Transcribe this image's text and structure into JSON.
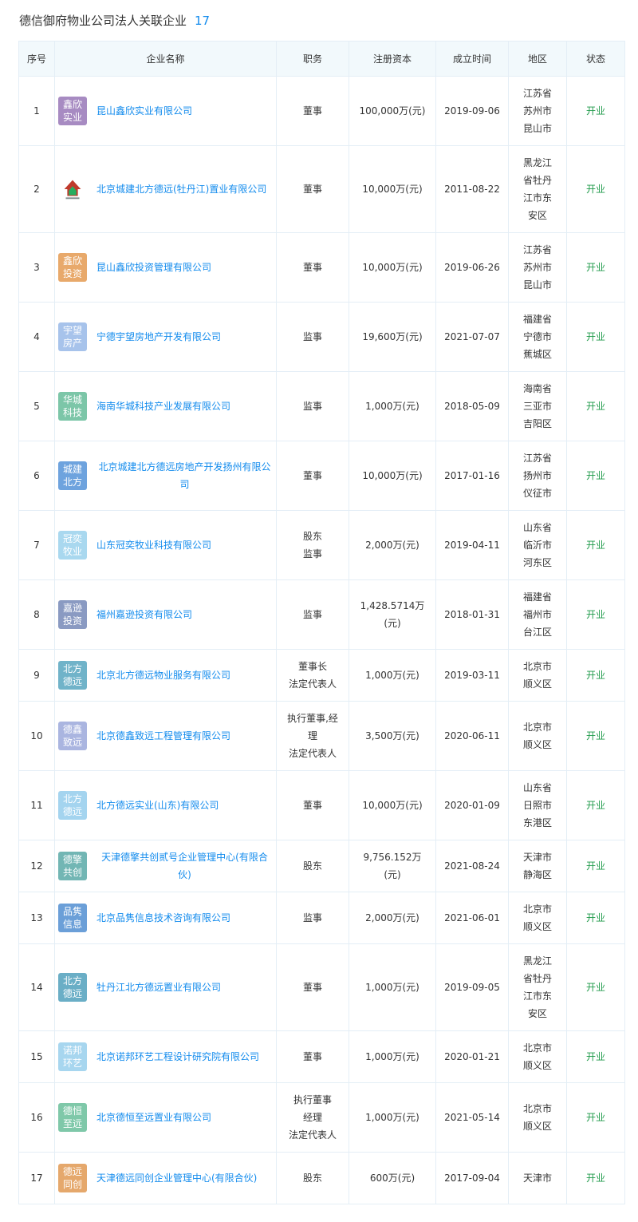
{
  "header": {
    "title": "德信御府物业公司法人关联企业",
    "count": "17"
  },
  "columns": [
    "序号",
    "企业名称",
    "职务",
    "注册资本",
    "成立时间",
    "地区",
    "状态"
  ],
  "rows": [
    {
      "no": "1",
      "logo_text": "鑫欣实业",
      "logo_color": "#a78bc2",
      "name": "昆山鑫欣实业有限公司",
      "role": "董事",
      "capital": "100,000万(元)",
      "date": "2019-09-06",
      "region": "江苏省\n苏州市\n昆山市",
      "status": "开业"
    },
    {
      "no": "2",
      "logo_text": "",
      "logo_color": "#ffffff",
      "logo_icon": "company-logo-image-icon",
      "name": "北京城建北方德远(牡丹江)置业有限公司",
      "role": "董事",
      "capital": "10,000万(元)",
      "date": "2011-08-22",
      "region": "黑龙江\n省牡丹\n江市东\n安区",
      "status": "开业"
    },
    {
      "no": "3",
      "logo_text": "鑫欣投资",
      "logo_color": "#e8a96b",
      "name": "昆山鑫欣投资管理有限公司",
      "role": "董事",
      "capital": "10,000万(元)",
      "date": "2019-06-26",
      "region": "江苏省\n苏州市\n昆山市",
      "status": "开业"
    },
    {
      "no": "4",
      "logo_text": "宇望房产",
      "logo_color": "#a7c3eb",
      "name": "宁德宇望房地产开发有限公司",
      "role": "监事",
      "capital": "19,600万(元)",
      "date": "2021-07-07",
      "region": "福建省\n宁德市\n蕉城区",
      "status": "开业"
    },
    {
      "no": "5",
      "logo_text": "华城科技",
      "logo_color": "#7cc6a8",
      "name": "海南华城科技产业发展有限公司",
      "role": "监事",
      "capital": "1,000万(元)",
      "date": "2018-05-09",
      "region": "海南省\n三亚市\n吉阳区",
      "status": "开业"
    },
    {
      "no": "6",
      "logo_text": "城建北方",
      "logo_color": "#6ea3de",
      "name": "北京城建北方德远房地产开发扬州有限公司",
      "role": "董事",
      "capital": "10,000万(元)",
      "date": "2017-01-16",
      "region": "江苏省\n扬州市\n仪征市",
      "status": "开业"
    },
    {
      "no": "7",
      "logo_text": "冠奕牧业",
      "logo_color": "#a9d8ef",
      "name": "山东冠奕牧业科技有限公司",
      "role": "股东\n监事",
      "capital": "2,000万(元)",
      "date": "2019-04-11",
      "region": "山东省\n临沂市\n河东区",
      "status": "开业"
    },
    {
      "no": "8",
      "logo_text": "嘉逊投资",
      "logo_color": "#8a9ac2",
      "name": "福州嘉逊投资有限公司",
      "role": "监事",
      "capital": "1,428.5714万\n(元)",
      "date": "2018-01-31",
      "region": "福建省\n福州市\n台江区",
      "status": "开业"
    },
    {
      "no": "9",
      "logo_text": "北方德远",
      "logo_color": "#70b3c9",
      "name": "北京北方德远物业服务有限公司",
      "role": "董事长\n法定代表人",
      "capital": "1,000万(元)",
      "date": "2019-03-11",
      "region": "北京市\n顺义区",
      "status": "开业"
    },
    {
      "no": "10",
      "logo_text": "德鑫致远",
      "logo_color": "#aab5e0",
      "name": "北京德鑫致远工程管理有限公司",
      "role": "执行董事,经\n理\n法定代表人",
      "capital": "3,500万(元)",
      "date": "2020-06-11",
      "region": "北京市\n顺义区",
      "status": "开业"
    },
    {
      "no": "11",
      "logo_text": "北方德远",
      "logo_color": "#a4d4ef",
      "name": "北方德远实业(山东)有限公司",
      "role": "董事",
      "capital": "10,000万(元)",
      "date": "2020-01-09",
      "region": "山东省\n日照市\n东港区",
      "status": "开业"
    },
    {
      "no": "12",
      "logo_text": "德擎共创",
      "logo_color": "#72b6b4",
      "name": "天津德擎共创贰号企业管理中心(有限合伙)",
      "role": "股东",
      "capital": "9,756.152万\n(元)",
      "date": "2021-08-24",
      "region": "天津市\n静海区",
      "status": "开业"
    },
    {
      "no": "13",
      "logo_text": "品隽信息",
      "logo_color": "#6b9fd8",
      "name": "北京品隽信息技术咨询有限公司",
      "role": "监事",
      "capital": "2,000万(元)",
      "date": "2021-06-01",
      "region": "北京市\n顺义区",
      "status": "开业"
    },
    {
      "no": "14",
      "logo_text": "北方德远",
      "logo_color": "#6aaec6",
      "name": "牡丹江北方德远置业有限公司",
      "role": "董事",
      "capital": "1,000万(元)",
      "date": "2019-09-05",
      "region": "黑龙江\n省牡丹\n江市东\n安区",
      "status": "开业"
    },
    {
      "no": "15",
      "logo_text": "诺邦环艺",
      "logo_color": "#a7d6ef",
      "name": "北京诺邦环艺工程设计研究院有限公司",
      "role": "董事",
      "capital": "1,000万(元)",
      "date": "2020-01-21",
      "region": "北京市\n顺义区",
      "status": "开业"
    },
    {
      "no": "16",
      "logo_text": "德恒至远",
      "logo_color": "#7fc8a9",
      "name": "北京德恒至远置业有限公司",
      "role": "执行董事\n经理\n法定代表人",
      "capital": "1,000万(元)",
      "date": "2021-05-14",
      "region": "北京市\n顺义区",
      "status": "开业"
    },
    {
      "no": "17",
      "logo_text": "德远同创",
      "logo_color": "#e5a86c",
      "name": "天津德远同创企业管理中心(有限合伙)",
      "role": "股东",
      "capital": "600万(元)",
      "date": "2017-09-04",
      "region": "天津市",
      "status": "开业"
    }
  ]
}
